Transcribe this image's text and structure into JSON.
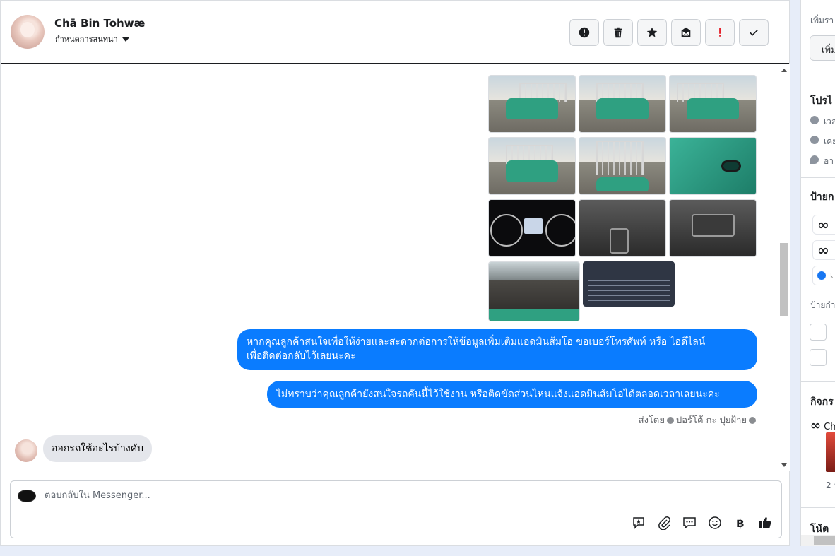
{
  "header": {
    "contact_name": "Chā Bin Tohwæ",
    "assign_label": "กำหนดการสนทนา"
  },
  "toolbar": {
    "buttons": [
      "alert-icon",
      "trash-icon",
      "star-icon",
      "mark-unread-icon",
      "spam-icon",
      "done-icon"
    ]
  },
  "messages": {
    "outgoing_1": "หากคุณลูกค้าสนใจเพื่อให้ง่ายและสะดวกต่อการให้ข้อมูลเพิ่มเติมแอดมินส้มโอ ขอเบอร์โทรศัพท์ หรือ ไอดีไลน์",
    "outgoing_1_line2": "เพื่อติดต่อกลับไว้เลยนะคะ",
    "outgoing_2": "ไม่ทราบว่าคุณลูกค้ายังสนใจรถคันนี้ไว้ใช้งาน หรือติดขัดส่วนไหนแจ้งแอดมินส้มโอได้ตลอดเวลาเลยนะคะ",
    "sent_by_prefix": "ส่งโดย",
    "sent_by_name": "ปอร์โต้ กะ ปุยฝ้าย",
    "incoming_1": "ออกรถใช้อะไรบ้างคับ"
  },
  "composer": {
    "placeholder": "ตอบกลับใน Messenger...",
    "currency_symbol": "฿"
  },
  "side": {
    "add_caption": "เพิ่มรา",
    "add_button": "เพิ่ม",
    "profile_title": "โปรไ",
    "row1": "เวล",
    "row2": "เคย",
    "row3": "อา",
    "labels_title": "ป้ายก",
    "add_label": "เ",
    "labels_sub": "ป้ายกำ",
    "activity_title": "กิจกร",
    "activity_item": "Ch",
    "activity_count": "2 ว",
    "notes_title": "โน้ต",
    "meta_symbol": "∞"
  },
  "colors": {
    "accent": "#0a7cff",
    "incoming_bubble": "#e4e6eb",
    "page_bg": "#e7edf9"
  }
}
